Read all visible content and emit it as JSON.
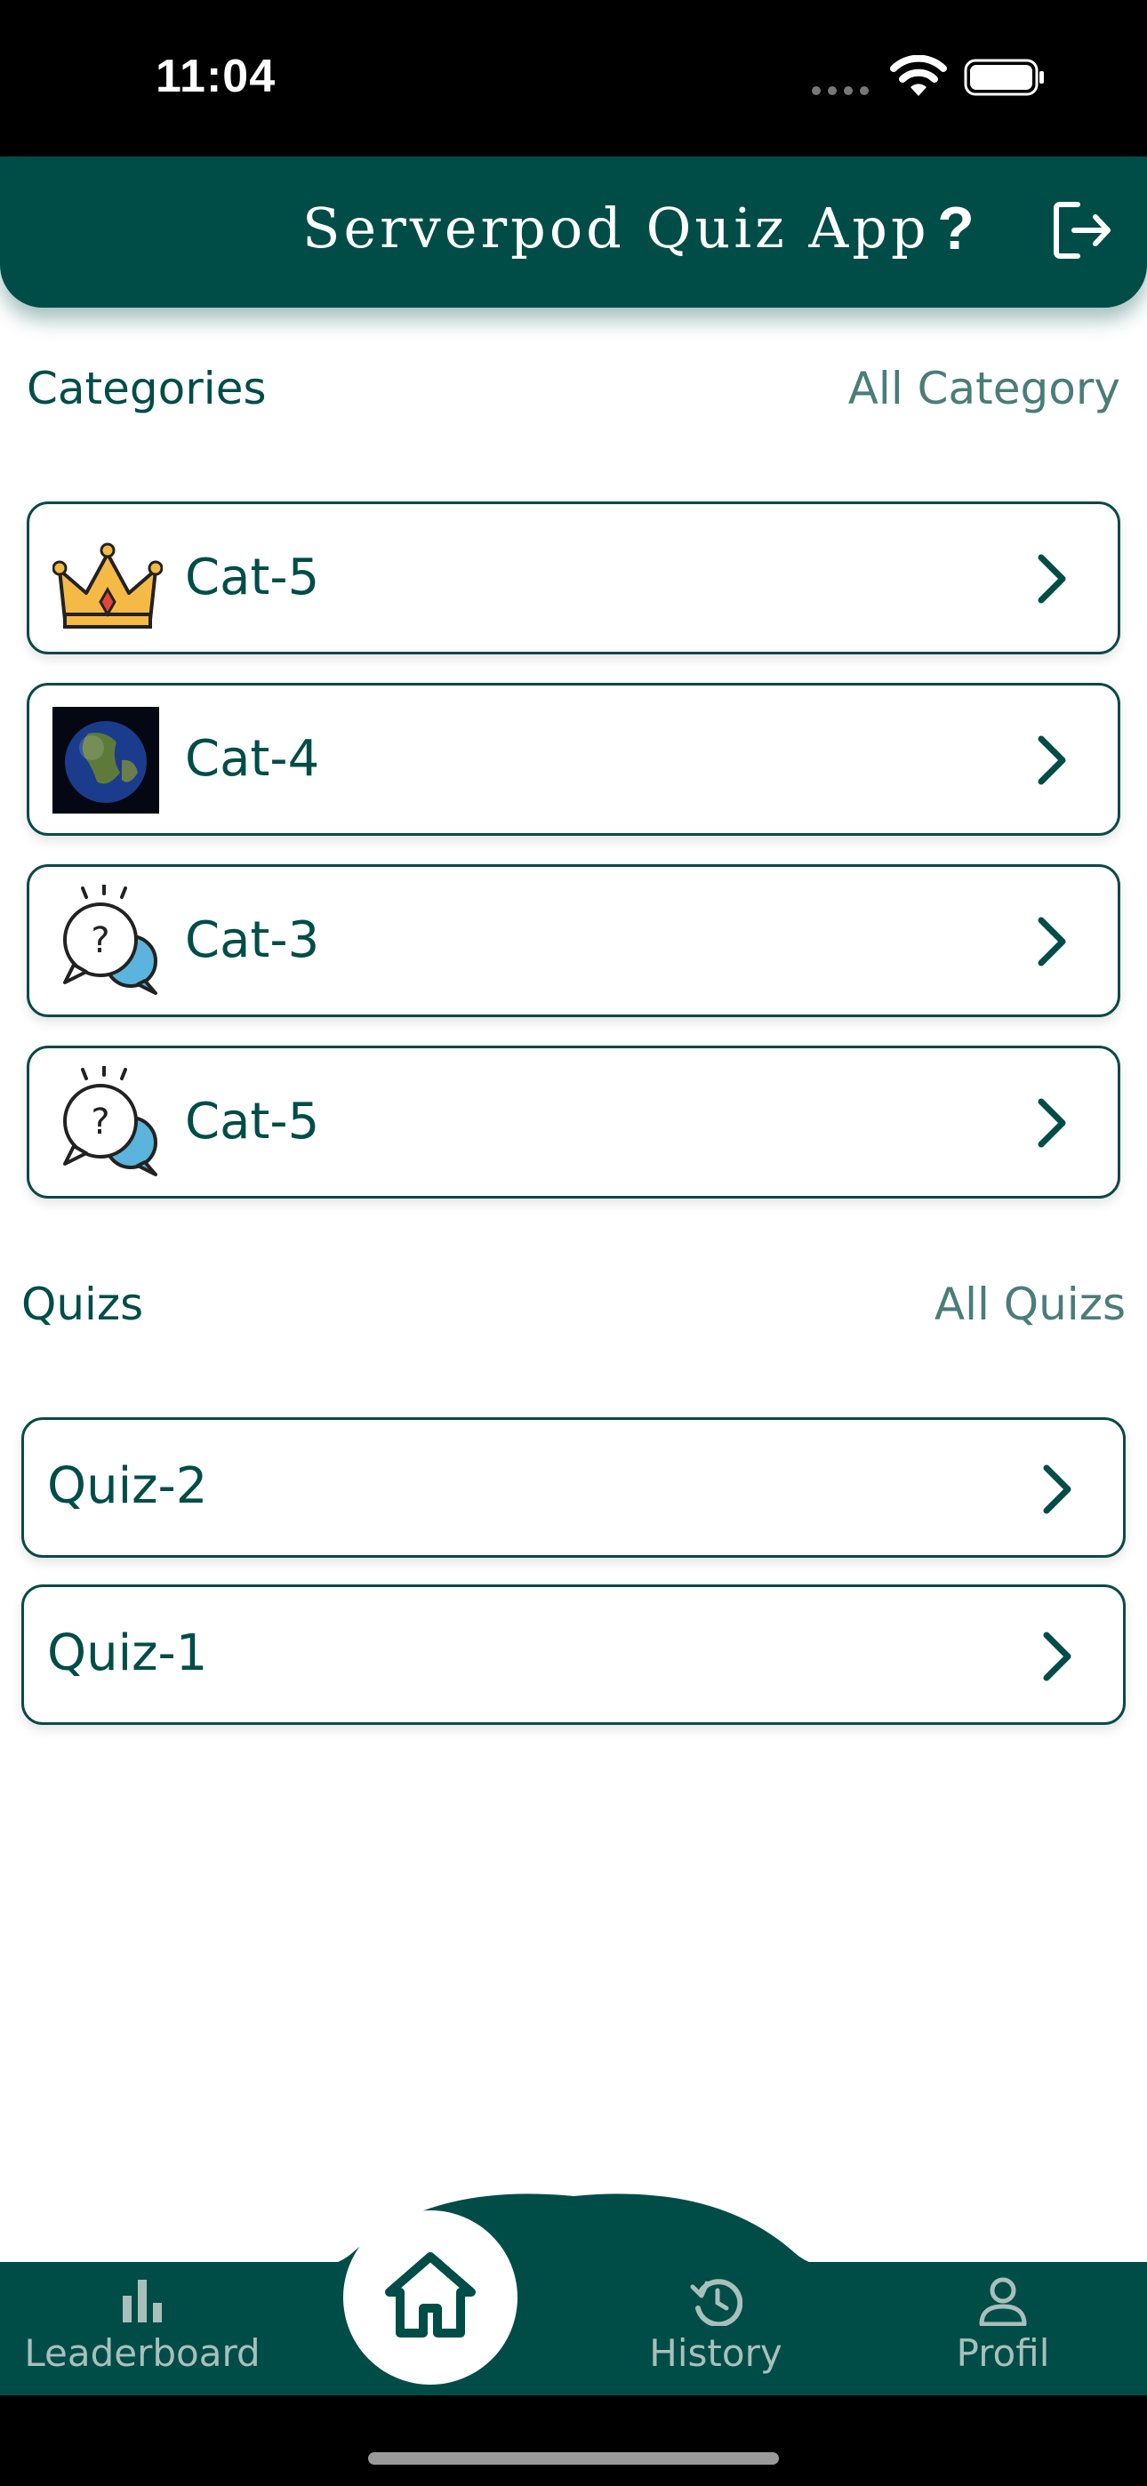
{
  "status_bar": {
    "time": "11:04"
  },
  "app_bar": {
    "title": "Serverpod Quiz App",
    "help_label": "?"
  },
  "categories_section": {
    "title": "Categories",
    "link": "All Category",
    "items": [
      {
        "label": "Cat-5",
        "icon": "crown-icon"
      },
      {
        "label": "Cat-4",
        "icon": "earth-image-icon"
      },
      {
        "label": "Cat-3",
        "icon": "question-bubbles-icon"
      },
      {
        "label": "Cat-5",
        "icon": "question-bubbles-icon"
      }
    ]
  },
  "quizzes_section": {
    "title": "Quizs",
    "link": "All Quizs",
    "items": [
      {
        "label": "Quiz-2"
      },
      {
        "label": "Quiz-1"
      }
    ]
  },
  "bottom_nav": {
    "items": [
      {
        "label": "Leaderboard",
        "icon": "bar-chart-icon"
      },
      {
        "label": "",
        "icon": "home-icon",
        "active": true
      },
      {
        "label": "History",
        "icon": "history-icon"
      },
      {
        "label": "Profil",
        "icon": "person-icon"
      }
    ]
  },
  "colors": {
    "primary": "#004d48",
    "link": "#4a7d78",
    "nav_inactive": "#a9bfbc",
    "background": "#ffffff"
  }
}
